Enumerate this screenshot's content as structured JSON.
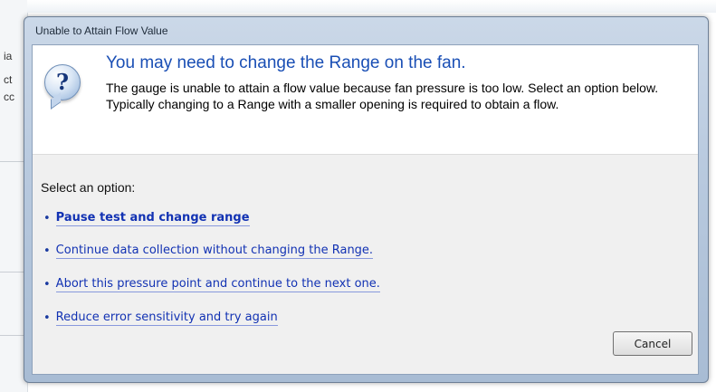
{
  "background": {
    "fragments": [
      "ia",
      "ct",
      "cc"
    ]
  },
  "dialog": {
    "title": "Unable to Attain Flow Value",
    "main_instruction": "You may need to change the Range on the fan.",
    "body": "The gauge is unable to attain a flow value because fan pressure is too low.  Select an option below. Typically changing to a Range with a smaller opening is required to obtain a flow.",
    "select_label": "Select an option:",
    "options": [
      {
        "label": "Pause test and change range"
      },
      {
        "label": "Continue data collection without changing the Range."
      },
      {
        "label": "Abort this pressure point and continue to the next one."
      },
      {
        "label": "Reduce error sensitivity and try again"
      }
    ],
    "cancel_label": "Cancel",
    "icon": "question-mark-icon",
    "colors": {
      "main_instruction": "#1a4fb5",
      "link": "#1232b3"
    }
  }
}
